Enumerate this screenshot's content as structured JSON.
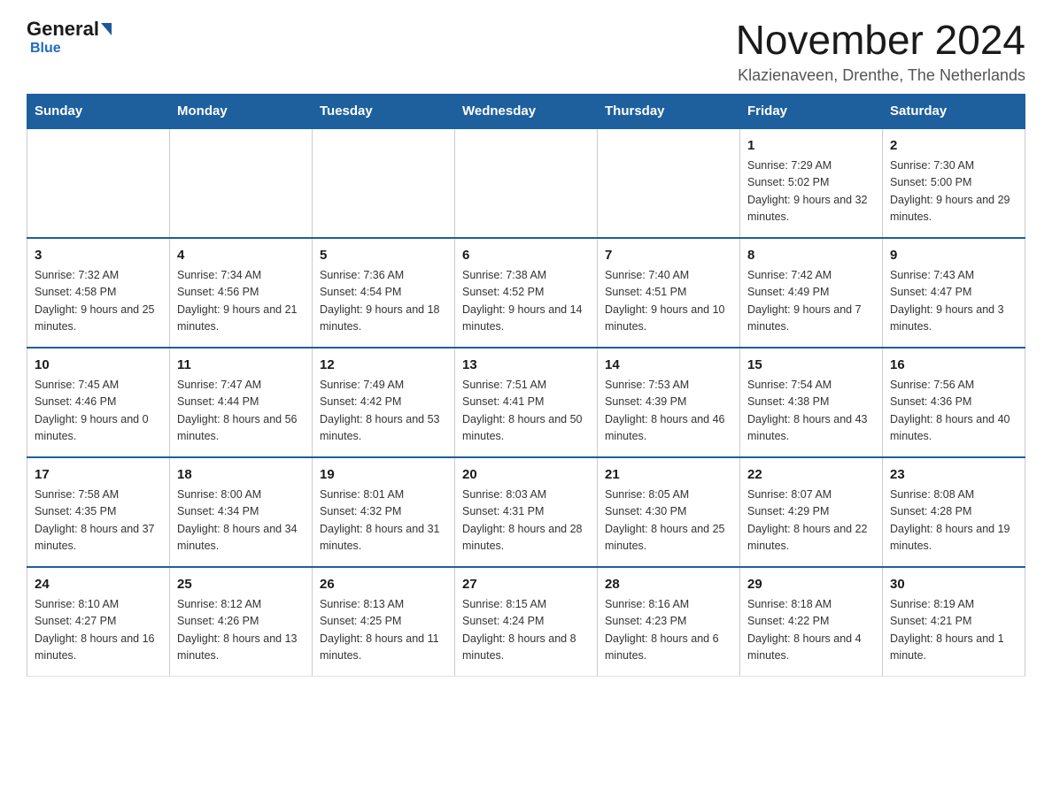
{
  "logo": {
    "general": "General",
    "blue": "Blue"
  },
  "title": "November 2024",
  "location": "Klazienaveen, Drenthe, The Netherlands",
  "headers": [
    "Sunday",
    "Monday",
    "Tuesday",
    "Wednesday",
    "Thursday",
    "Friday",
    "Saturday"
  ],
  "rows": [
    [
      {
        "day": "",
        "info": ""
      },
      {
        "day": "",
        "info": ""
      },
      {
        "day": "",
        "info": ""
      },
      {
        "day": "",
        "info": ""
      },
      {
        "day": "",
        "info": ""
      },
      {
        "day": "1",
        "info": "Sunrise: 7:29 AM\nSunset: 5:02 PM\nDaylight: 9 hours and 32 minutes."
      },
      {
        "day": "2",
        "info": "Sunrise: 7:30 AM\nSunset: 5:00 PM\nDaylight: 9 hours and 29 minutes."
      }
    ],
    [
      {
        "day": "3",
        "info": "Sunrise: 7:32 AM\nSunset: 4:58 PM\nDaylight: 9 hours and 25 minutes."
      },
      {
        "day": "4",
        "info": "Sunrise: 7:34 AM\nSunset: 4:56 PM\nDaylight: 9 hours and 21 minutes."
      },
      {
        "day": "5",
        "info": "Sunrise: 7:36 AM\nSunset: 4:54 PM\nDaylight: 9 hours and 18 minutes."
      },
      {
        "day": "6",
        "info": "Sunrise: 7:38 AM\nSunset: 4:52 PM\nDaylight: 9 hours and 14 minutes."
      },
      {
        "day": "7",
        "info": "Sunrise: 7:40 AM\nSunset: 4:51 PM\nDaylight: 9 hours and 10 minutes."
      },
      {
        "day": "8",
        "info": "Sunrise: 7:42 AM\nSunset: 4:49 PM\nDaylight: 9 hours and 7 minutes."
      },
      {
        "day": "9",
        "info": "Sunrise: 7:43 AM\nSunset: 4:47 PM\nDaylight: 9 hours and 3 minutes."
      }
    ],
    [
      {
        "day": "10",
        "info": "Sunrise: 7:45 AM\nSunset: 4:46 PM\nDaylight: 9 hours and 0 minutes."
      },
      {
        "day": "11",
        "info": "Sunrise: 7:47 AM\nSunset: 4:44 PM\nDaylight: 8 hours and 56 minutes."
      },
      {
        "day": "12",
        "info": "Sunrise: 7:49 AM\nSunset: 4:42 PM\nDaylight: 8 hours and 53 minutes."
      },
      {
        "day": "13",
        "info": "Sunrise: 7:51 AM\nSunset: 4:41 PM\nDaylight: 8 hours and 50 minutes."
      },
      {
        "day": "14",
        "info": "Sunrise: 7:53 AM\nSunset: 4:39 PM\nDaylight: 8 hours and 46 minutes."
      },
      {
        "day": "15",
        "info": "Sunrise: 7:54 AM\nSunset: 4:38 PM\nDaylight: 8 hours and 43 minutes."
      },
      {
        "day": "16",
        "info": "Sunrise: 7:56 AM\nSunset: 4:36 PM\nDaylight: 8 hours and 40 minutes."
      }
    ],
    [
      {
        "day": "17",
        "info": "Sunrise: 7:58 AM\nSunset: 4:35 PM\nDaylight: 8 hours and 37 minutes."
      },
      {
        "day": "18",
        "info": "Sunrise: 8:00 AM\nSunset: 4:34 PM\nDaylight: 8 hours and 34 minutes."
      },
      {
        "day": "19",
        "info": "Sunrise: 8:01 AM\nSunset: 4:32 PM\nDaylight: 8 hours and 31 minutes."
      },
      {
        "day": "20",
        "info": "Sunrise: 8:03 AM\nSunset: 4:31 PM\nDaylight: 8 hours and 28 minutes."
      },
      {
        "day": "21",
        "info": "Sunrise: 8:05 AM\nSunset: 4:30 PM\nDaylight: 8 hours and 25 minutes."
      },
      {
        "day": "22",
        "info": "Sunrise: 8:07 AM\nSunset: 4:29 PM\nDaylight: 8 hours and 22 minutes."
      },
      {
        "day": "23",
        "info": "Sunrise: 8:08 AM\nSunset: 4:28 PM\nDaylight: 8 hours and 19 minutes."
      }
    ],
    [
      {
        "day": "24",
        "info": "Sunrise: 8:10 AM\nSunset: 4:27 PM\nDaylight: 8 hours and 16 minutes."
      },
      {
        "day": "25",
        "info": "Sunrise: 8:12 AM\nSunset: 4:26 PM\nDaylight: 8 hours and 13 minutes."
      },
      {
        "day": "26",
        "info": "Sunrise: 8:13 AM\nSunset: 4:25 PM\nDaylight: 8 hours and 11 minutes."
      },
      {
        "day": "27",
        "info": "Sunrise: 8:15 AM\nSunset: 4:24 PM\nDaylight: 8 hours and 8 minutes."
      },
      {
        "day": "28",
        "info": "Sunrise: 8:16 AM\nSunset: 4:23 PM\nDaylight: 8 hours and 6 minutes."
      },
      {
        "day": "29",
        "info": "Sunrise: 8:18 AM\nSunset: 4:22 PM\nDaylight: 8 hours and 4 minutes."
      },
      {
        "day": "30",
        "info": "Sunrise: 8:19 AM\nSunset: 4:21 PM\nDaylight: 8 hours and 1 minute."
      }
    ]
  ]
}
